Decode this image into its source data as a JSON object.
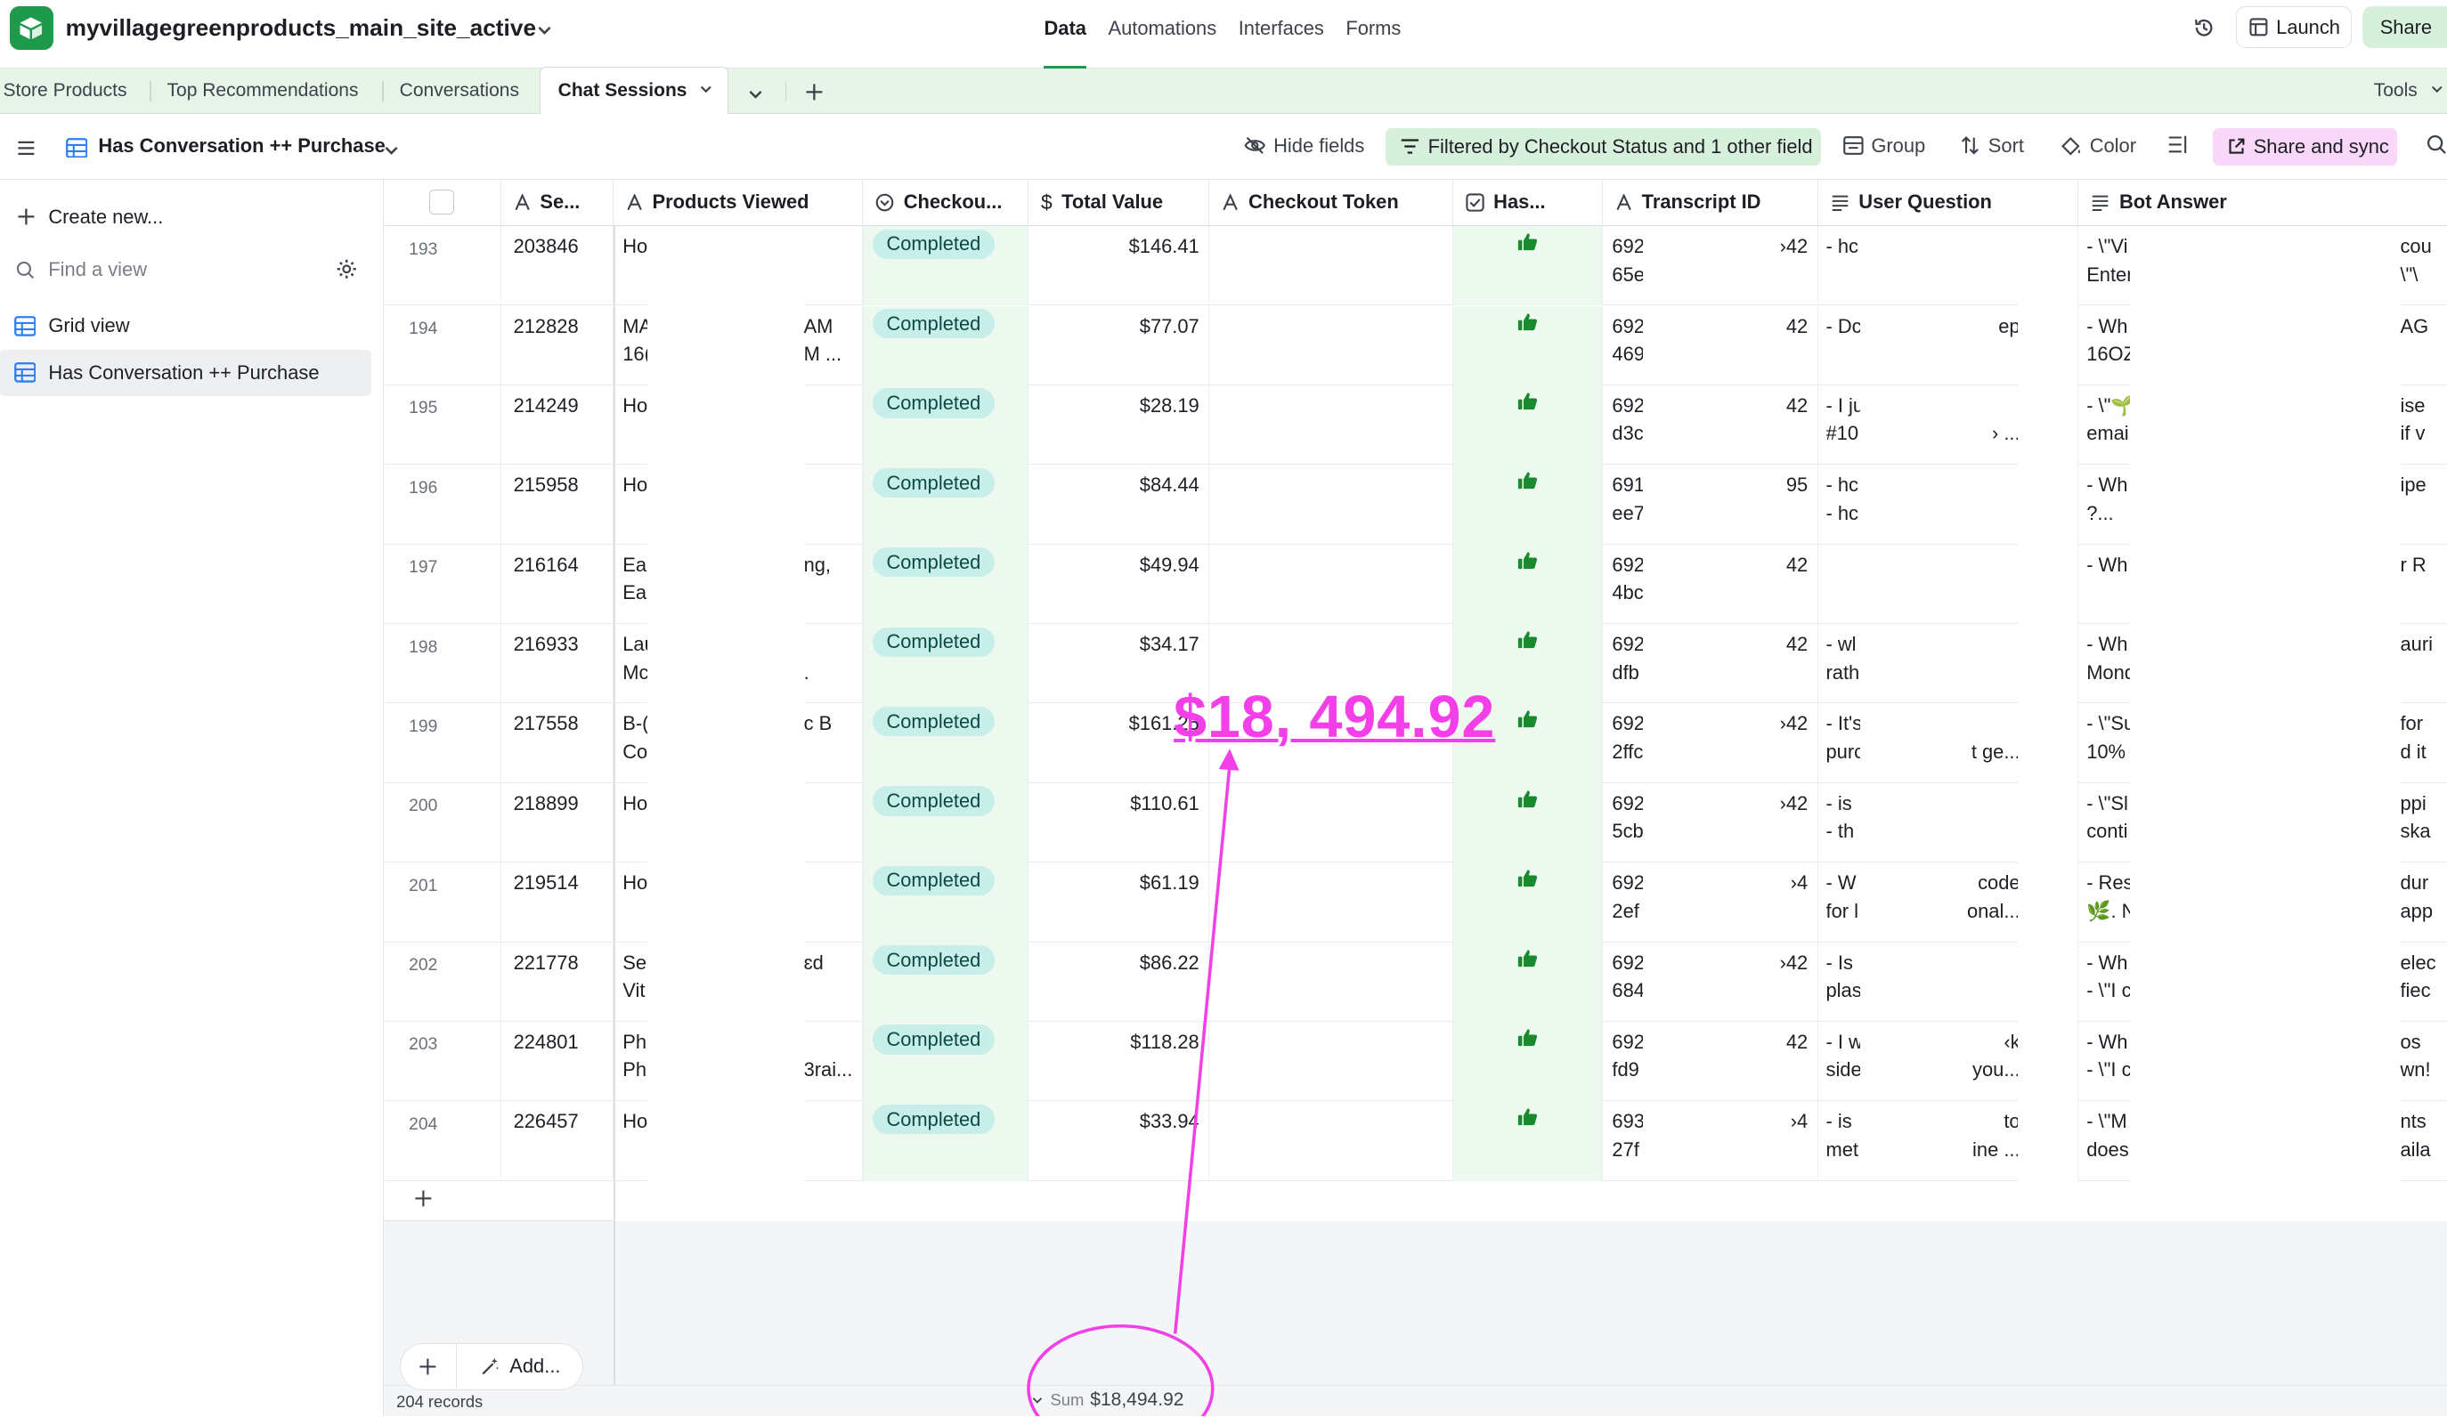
{
  "app": {
    "base_name": "myvillagegreenproducts_main_site_active",
    "nav": [
      "Data",
      "Automations",
      "Interfaces",
      "Forms"
    ],
    "active_nav": "Data",
    "launch_label": "Launch",
    "share_label": "Share"
  },
  "tabs": {
    "items": [
      "Store Products",
      "Top Recommendations",
      "Conversations",
      "Chat Sessions"
    ],
    "active": "Chat Sessions",
    "tools_label": "Tools"
  },
  "viewbar": {
    "view_name": "Has Conversation ++ Purchase",
    "hide_fields": "Hide fields",
    "filter": "Filtered by Checkout Status and 1 other field",
    "group": "Group",
    "sort": "Sort",
    "color": "Color",
    "share_sync": "Share and sync"
  },
  "sidebar": {
    "create_new": "Create new...",
    "find_placeholder": "Find a view",
    "views": [
      "Grid view",
      "Has Conversation ++ Purchase"
    ],
    "selected_view": "Has Conversation ++ Purchase"
  },
  "columns": [
    "Se...",
    "Products Viewed",
    "Checkou...",
    "Total Value",
    "Checkout Token",
    "Has...",
    "Transcript ID",
    "User Question",
    "Bot Answer"
  ],
  "rows": [
    {
      "num": "193",
      "session": "203846",
      "pv1": "Ho",
      "pv1b": "",
      "pv2": "",
      "pv2b": "",
      "status": "Completed",
      "total": "$146.41",
      "tid1": "692",
      "tid2": "65e",
      "tidr": "›42",
      "uq1": "- hc",
      "uq2": "",
      "uqr": "",
      "uqr2": "",
      "ba1": "- \\\"Vi",
      "ba2": "Enter",
      "bar": "cou",
      "bar2": "\\\"\\"
    },
    {
      "num": "194",
      "session": "212828",
      "pv1": "MA",
      "pv1b": "16(",
      "pv2": "AM",
      "pv2b": "M ...",
      "status": "Completed",
      "total": "$77.07",
      "tid1": "692",
      "tid2": "469",
      "tidr": "42",
      "uq1": "- Dc",
      "uq2": "",
      "uqr": "ep",
      "uqr2": "",
      "ba1": "- Wh",
      "ba2": "16OZ",
      "bar": "AG",
      "bar2": ""
    },
    {
      "num": "195",
      "session": "214249",
      "pv1": "Ho",
      "pv1b": "",
      "pv2": "",
      "pv2b": "",
      "status": "Completed",
      "total": "$28.19",
      "tid1": "692",
      "tid2": "d3c",
      "tidr": "42",
      "uq1": "- I ju",
      "uq2": "#10",
      "uqr": "",
      "uqr2": "› ...",
      "ba1": "- \\\"🌱",
      "ba2": "email",
      "bar": "ise",
      "bar2": "if v"
    },
    {
      "num": "196",
      "session": "215958",
      "pv1": "Ho",
      "pv1b": "",
      "pv2": "",
      "pv2b": "",
      "status": "Completed",
      "total": "$84.44",
      "tid1": "691",
      "tid2": "ee7",
      "tidr": "95",
      "uq1": "- hc",
      "uq2": "- hc",
      "uqr": "",
      "uqr2": "",
      "ba1": "- Wh",
      "ba2": "?...",
      "bar": "ipe",
      "bar2": ""
    },
    {
      "num": "197",
      "session": "216164",
      "pv1": "Ear",
      "pv1b": "Ear",
      "pv2": "ng,",
      "pv2b": "",
      "status": "Completed",
      "total": "$49.94",
      "tid1": "692",
      "tid2": "4bc",
      "tidr": "42",
      "uq1": "",
      "uq2": "",
      "uqr": "",
      "uqr2": "",
      "ba1": "- Wh",
      "ba2": "",
      "bar": "r R",
      "bar2": ""
    },
    {
      "num": "198",
      "session": "216933",
      "pv1": "Lau",
      "pv1b": "Mc",
      "pv2": "",
      "pv2b": ".",
      "status": "Completed",
      "total": "$34.17",
      "tid1": "692",
      "tid2": "dfb",
      "tidr": "42",
      "uq1": "- wl",
      "uq2": "rath",
      "uqr": "",
      "uqr2": "",
      "ba1": "- Wh",
      "ba2": "Mond",
      "bar": "auri",
      "bar2": ""
    },
    {
      "num": "199",
      "session": "217558",
      "pv1": "B-(",
      "pv1b": "Co",
      "pv2": "c B",
      "pv2b": "",
      "status": "Completed",
      "total": "$161.25",
      "tid1": "692",
      "tid2": "2ffc",
      "tidr": "›42",
      "uq1": "- It's",
      "uq2": "purc",
      "uqr": "",
      "uqr2": "t ge...",
      "ba1": "- \\\"Su",
      "ba2": "10%",
      "bar": "for",
      "bar2": "d it"
    },
    {
      "num": "200",
      "session": "218899",
      "pv1": "Ho",
      "pv1b": "",
      "pv2": "",
      "pv2b": "",
      "status": "Completed",
      "total": "$110.61",
      "tid1": "692",
      "tid2": "5cb",
      "tidr": "›42",
      "uq1": "- is",
      "uq2": "- th",
      "uqr": "",
      "uqr2": "",
      "ba1": "- \\\"Sl",
      "ba2": "conti",
      "bar": "ppi",
      "bar2": "ska"
    },
    {
      "num": "201",
      "session": "219514",
      "pv1": "Ho",
      "pv1b": "",
      "pv2": "",
      "pv2b": "",
      "status": "Completed",
      "total": "$61.19",
      "tid1": "692",
      "tid2": "2ef",
      "tidr": "›4",
      "uq1": "- W",
      "uq2": "for l",
      "uqr": "code",
      "uqr2": "onal...",
      "ba1": "- Res",
      "ba2": "🌿. N",
      "bar": "dur",
      "bar2": "app"
    },
    {
      "num": "202",
      "session": "221778",
      "pv1": "Sel",
      "pv1b": "Vit",
      "pv2": "ɛd",
      "pv2b": "",
      "status": "Completed",
      "total": "$86.22",
      "tid1": "692",
      "tid2": "684",
      "tidr": "›42",
      "uq1": "- Is",
      "uq2": "plas",
      "uqr": "",
      "uqr2": "",
      "ba1": "- Wh",
      "ba2": "- \\\"I c",
      "bar": "elec",
      "bar2": "fiec"
    },
    {
      "num": "203",
      "session": "224801",
      "pv1": "Ph",
      "pv1b": "Ph",
      "pv2": "",
      "pv2b": "3rai...",
      "status": "Completed",
      "total": "$118.28",
      "tid1": "692",
      "tid2": "fd9",
      "tidr": "42",
      "uq1": "- I w",
      "uq2": "side",
      "uqr": "‹k",
      "uqr2": "you...",
      "ba1": "- Wh",
      "ba2": "- \\\"I c",
      "bar": "os",
      "bar2": "wn!"
    },
    {
      "num": "204",
      "session": "226457",
      "pv1": "Ho",
      "pv1b": "",
      "pv2": "",
      "pv2b": "",
      "status": "Completed",
      "total": "$33.94",
      "tid1": "693",
      "tid2": "27f",
      "tidr": "›4",
      "uq1": "- is",
      "uq2": "met",
      "uqr": "to",
      "uqr2": "ine ...",
      "ba1": "- \\\"M",
      "ba2": "does",
      "bar": "nts",
      "bar2": "aila"
    }
  ],
  "footer": {
    "records": "204 records",
    "sum_label": "Sum",
    "sum_value": "$18,494.92",
    "add_label": "Add..."
  },
  "annotation": {
    "text": "$18, 494.92",
    "color": "#f23fe7"
  }
}
